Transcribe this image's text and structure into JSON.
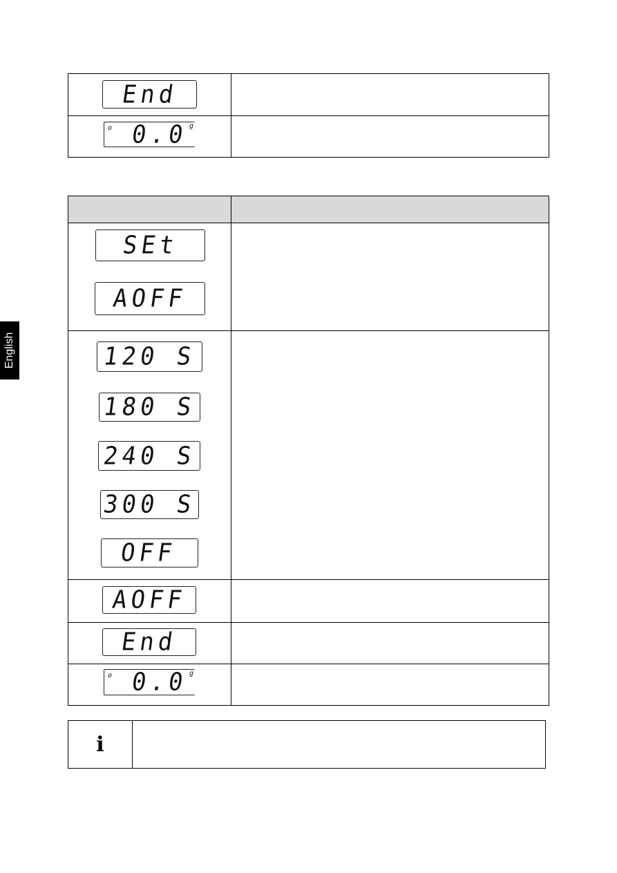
{
  "side_tab": {
    "label": "English"
  },
  "table1": {
    "rows": [
      {
        "display": "End"
      },
      {
        "display": "0.0",
        "unit": "g",
        "indicator": "o"
      }
    ]
  },
  "table2": {
    "rows": [
      {
        "displays": [
          "SEt",
          "AOFF"
        ]
      },
      {
        "displays": [
          "120 S",
          "180 S",
          "240 S",
          "300 S",
          "OFF"
        ]
      },
      {
        "displays": [
          "AOFF"
        ]
      },
      {
        "displays": [
          "End"
        ]
      },
      {
        "displays": [
          "0.0"
        ],
        "unit": "g",
        "indicator": "o"
      }
    ]
  },
  "info_box": {
    "icon": "info-icon",
    "glyph": "i"
  }
}
